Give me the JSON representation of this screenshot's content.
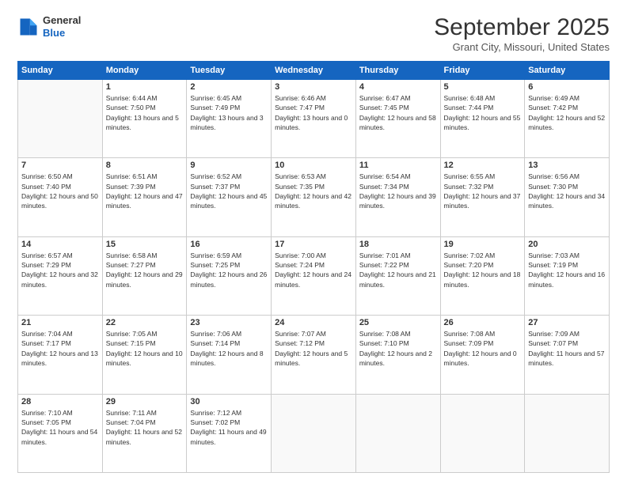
{
  "header": {
    "logo_line1": "General",
    "logo_line2": "Blue",
    "month": "September 2025",
    "location": "Grant City, Missouri, United States"
  },
  "days_of_week": [
    "Sunday",
    "Monday",
    "Tuesday",
    "Wednesday",
    "Thursday",
    "Friday",
    "Saturday"
  ],
  "weeks": [
    [
      {
        "day": "",
        "sunrise": "",
        "sunset": "",
        "daylight": ""
      },
      {
        "day": "1",
        "sunrise": "Sunrise: 6:44 AM",
        "sunset": "Sunset: 7:50 PM",
        "daylight": "Daylight: 13 hours and 5 minutes."
      },
      {
        "day": "2",
        "sunrise": "Sunrise: 6:45 AM",
        "sunset": "Sunset: 7:49 PM",
        "daylight": "Daylight: 13 hours and 3 minutes."
      },
      {
        "day": "3",
        "sunrise": "Sunrise: 6:46 AM",
        "sunset": "Sunset: 7:47 PM",
        "daylight": "Daylight: 13 hours and 0 minutes."
      },
      {
        "day": "4",
        "sunrise": "Sunrise: 6:47 AM",
        "sunset": "Sunset: 7:45 PM",
        "daylight": "Daylight: 12 hours and 58 minutes."
      },
      {
        "day": "5",
        "sunrise": "Sunrise: 6:48 AM",
        "sunset": "Sunset: 7:44 PM",
        "daylight": "Daylight: 12 hours and 55 minutes."
      },
      {
        "day": "6",
        "sunrise": "Sunrise: 6:49 AM",
        "sunset": "Sunset: 7:42 PM",
        "daylight": "Daylight: 12 hours and 52 minutes."
      }
    ],
    [
      {
        "day": "7",
        "sunrise": "Sunrise: 6:50 AM",
        "sunset": "Sunset: 7:40 PM",
        "daylight": "Daylight: 12 hours and 50 minutes."
      },
      {
        "day": "8",
        "sunrise": "Sunrise: 6:51 AM",
        "sunset": "Sunset: 7:39 PM",
        "daylight": "Daylight: 12 hours and 47 minutes."
      },
      {
        "day": "9",
        "sunrise": "Sunrise: 6:52 AM",
        "sunset": "Sunset: 7:37 PM",
        "daylight": "Daylight: 12 hours and 45 minutes."
      },
      {
        "day": "10",
        "sunrise": "Sunrise: 6:53 AM",
        "sunset": "Sunset: 7:35 PM",
        "daylight": "Daylight: 12 hours and 42 minutes."
      },
      {
        "day": "11",
        "sunrise": "Sunrise: 6:54 AM",
        "sunset": "Sunset: 7:34 PM",
        "daylight": "Daylight: 12 hours and 39 minutes."
      },
      {
        "day": "12",
        "sunrise": "Sunrise: 6:55 AM",
        "sunset": "Sunset: 7:32 PM",
        "daylight": "Daylight: 12 hours and 37 minutes."
      },
      {
        "day": "13",
        "sunrise": "Sunrise: 6:56 AM",
        "sunset": "Sunset: 7:30 PM",
        "daylight": "Daylight: 12 hours and 34 minutes."
      }
    ],
    [
      {
        "day": "14",
        "sunrise": "Sunrise: 6:57 AM",
        "sunset": "Sunset: 7:29 PM",
        "daylight": "Daylight: 12 hours and 32 minutes."
      },
      {
        "day": "15",
        "sunrise": "Sunrise: 6:58 AM",
        "sunset": "Sunset: 7:27 PM",
        "daylight": "Daylight: 12 hours and 29 minutes."
      },
      {
        "day": "16",
        "sunrise": "Sunrise: 6:59 AM",
        "sunset": "Sunset: 7:25 PM",
        "daylight": "Daylight: 12 hours and 26 minutes."
      },
      {
        "day": "17",
        "sunrise": "Sunrise: 7:00 AM",
        "sunset": "Sunset: 7:24 PM",
        "daylight": "Daylight: 12 hours and 24 minutes."
      },
      {
        "day": "18",
        "sunrise": "Sunrise: 7:01 AM",
        "sunset": "Sunset: 7:22 PM",
        "daylight": "Daylight: 12 hours and 21 minutes."
      },
      {
        "day": "19",
        "sunrise": "Sunrise: 7:02 AM",
        "sunset": "Sunset: 7:20 PM",
        "daylight": "Daylight: 12 hours and 18 minutes."
      },
      {
        "day": "20",
        "sunrise": "Sunrise: 7:03 AM",
        "sunset": "Sunset: 7:19 PM",
        "daylight": "Daylight: 12 hours and 16 minutes."
      }
    ],
    [
      {
        "day": "21",
        "sunrise": "Sunrise: 7:04 AM",
        "sunset": "Sunset: 7:17 PM",
        "daylight": "Daylight: 12 hours and 13 minutes."
      },
      {
        "day": "22",
        "sunrise": "Sunrise: 7:05 AM",
        "sunset": "Sunset: 7:15 PM",
        "daylight": "Daylight: 12 hours and 10 minutes."
      },
      {
        "day": "23",
        "sunrise": "Sunrise: 7:06 AM",
        "sunset": "Sunset: 7:14 PM",
        "daylight": "Daylight: 12 hours and 8 minutes."
      },
      {
        "day": "24",
        "sunrise": "Sunrise: 7:07 AM",
        "sunset": "Sunset: 7:12 PM",
        "daylight": "Daylight: 12 hours and 5 minutes."
      },
      {
        "day": "25",
        "sunrise": "Sunrise: 7:08 AM",
        "sunset": "Sunset: 7:10 PM",
        "daylight": "Daylight: 12 hours and 2 minutes."
      },
      {
        "day": "26",
        "sunrise": "Sunrise: 7:08 AM",
        "sunset": "Sunset: 7:09 PM",
        "daylight": "Daylight: 12 hours and 0 minutes."
      },
      {
        "day": "27",
        "sunrise": "Sunrise: 7:09 AM",
        "sunset": "Sunset: 7:07 PM",
        "daylight": "Daylight: 11 hours and 57 minutes."
      }
    ],
    [
      {
        "day": "28",
        "sunrise": "Sunrise: 7:10 AM",
        "sunset": "Sunset: 7:05 PM",
        "daylight": "Daylight: 11 hours and 54 minutes."
      },
      {
        "day": "29",
        "sunrise": "Sunrise: 7:11 AM",
        "sunset": "Sunset: 7:04 PM",
        "daylight": "Daylight: 11 hours and 52 minutes."
      },
      {
        "day": "30",
        "sunrise": "Sunrise: 7:12 AM",
        "sunset": "Sunset: 7:02 PM",
        "daylight": "Daylight: 11 hours and 49 minutes."
      },
      {
        "day": "",
        "sunrise": "",
        "sunset": "",
        "daylight": ""
      },
      {
        "day": "",
        "sunrise": "",
        "sunset": "",
        "daylight": ""
      },
      {
        "day": "",
        "sunrise": "",
        "sunset": "",
        "daylight": ""
      },
      {
        "day": "",
        "sunrise": "",
        "sunset": "",
        "daylight": ""
      }
    ]
  ]
}
